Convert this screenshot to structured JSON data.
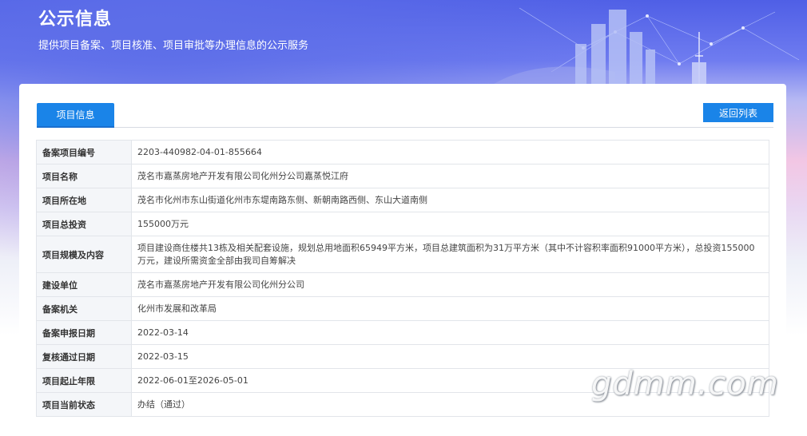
{
  "header": {
    "title": "公示信息",
    "subtitle": "提供项目备案、项目核准、项目审批等办理信息的公示服务"
  },
  "tabs": [
    {
      "label": "项目信息",
      "active": true
    }
  ],
  "toolbar": {
    "back_label": "返回列表"
  },
  "rows": [
    {
      "label": "备案项目编号",
      "value": "2203-440982-04-01-855664"
    },
    {
      "label": "项目名称",
      "value": "茂名市嘉蒸房地产开发有限公司化州分公司嘉蒸悦江府"
    },
    {
      "label": "项目所在地",
      "value": "茂名市化州市东山街道化州市东堤南路东侧、新朝南路西侧、东山大道南侧"
    },
    {
      "label": "项目总投资",
      "value": "155000万元"
    },
    {
      "label": "项目规模及内容",
      "value": "项目建设商住楼共13栋及相关配套设施，规划总用地面积65949平方米，项目总建筑面积为31万平方米（其中不计容积率面积91000平方米），总投资155000万元，建设所需资金全部由我司自筹解决"
    },
    {
      "label": "建设单位",
      "value": "茂名市嘉蒸房地产开发有限公司化州分公司"
    },
    {
      "label": "备案机关",
      "value": "化州市发展和改革局"
    },
    {
      "label": "备案申报日期",
      "value": "2022-03-14"
    },
    {
      "label": "复核通过日期",
      "value": "2022-03-15"
    },
    {
      "label": "项目起止年限",
      "value": "2022-06-01至2026-05-01"
    },
    {
      "label": "项目当前状态",
      "value": "办结（通过）"
    }
  ],
  "watermark": "gdmm.com",
  "colors": {
    "accent": "#1a84e8"
  }
}
